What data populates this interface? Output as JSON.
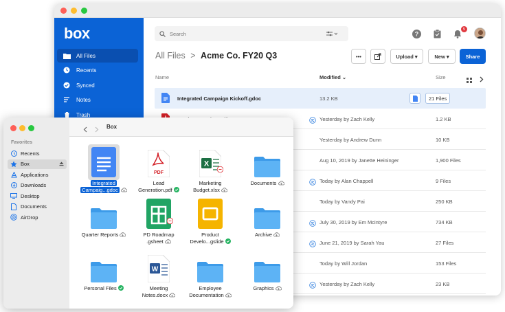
{
  "web": {
    "logo": "box",
    "nav": [
      {
        "label": "All Files",
        "icon": "folder-icon"
      },
      {
        "label": "Recents",
        "icon": "clock-icon"
      },
      {
        "label": "Synced",
        "icon": "check-circle-icon"
      },
      {
        "label": "Notes",
        "icon": "notes-icon"
      },
      {
        "label": "Trash",
        "icon": "trash-icon"
      }
    ],
    "search_placeholder": "Search",
    "notification_count": "5",
    "breadcrumb_parent": "All Files",
    "breadcrumb_sep": ">",
    "breadcrumb_current": "Acme Co. FY20 Q3",
    "more_label": "•••",
    "upload_label": "Upload ▾",
    "new_label": "New ▾",
    "share_label": "Share",
    "columns": {
      "name": "Name",
      "modified": "Modified ⌄",
      "size": "Size"
    },
    "files_count_label": "21 Files",
    "rows": [
      {
        "name": "Integrated Campaign Kickoff.gdoc",
        "modified": "13.2 KB",
        "size": "",
        "type": "gdoc",
        "synced": false,
        "selected": true
      },
      {
        "name": "Lead Generation.pdf",
        "modified": "Yesterday by Zach Kelly",
        "size": "1.2 KB",
        "type": "pdf",
        "synced": true
      },
      {
        "name": "",
        "modified": "Yesterday by Andrew Dunn",
        "size": "10 KB",
        "type": "none",
        "synced": false
      },
      {
        "name": "",
        "modified": "Aug 10, 2019 by Janette Heininger",
        "size": "1,900 Files",
        "type": "none",
        "synced": false
      },
      {
        "name": "",
        "modified": "Today by Alan Chappell",
        "size": "9 Files",
        "type": "none",
        "synced": true
      },
      {
        "name": "",
        "modified": "Today by Vandy Pai",
        "size": "250 KB",
        "type": "none",
        "synced": false
      },
      {
        "name": "",
        "modified": "July 30, 2019 by Em Mcintyre",
        "size": "734 KB",
        "type": "none",
        "synced": true
      },
      {
        "name": "",
        "modified": "June 21, 2019 by Sarah Yau",
        "size": "27 Files",
        "type": "none",
        "synced": true
      },
      {
        "name": "",
        "modified": "Today by Will Jordan",
        "size": "153 Files",
        "type": "none",
        "synced": false
      },
      {
        "name": "",
        "modified": "Yesterday by Zach Kelly",
        "size": "23 KB",
        "type": "none",
        "synced": true
      }
    ]
  },
  "finder": {
    "title": "Box",
    "favorites_header": "Favorites",
    "sidebar": [
      "Recents",
      "Box",
      "Applications",
      "Downloads",
      "Desktop",
      "Documents",
      "AirDrop"
    ],
    "items": [
      {
        "line1": "Integrated",
        "line2": "Campaig...gdoc",
        "kind": "gdoc",
        "status": "cloud"
      },
      {
        "line1": "Lead",
        "line2": "Generation.pdf",
        "kind": "pdf",
        "status": "check"
      },
      {
        "line1": "Marketing",
        "line2": "Budget.xlsx",
        "kind": "xlsx",
        "status": "cloud"
      },
      {
        "line1": "",
        "line2": "Documents",
        "kind": "folder",
        "status": "cloud"
      },
      {
        "line1": "",
        "line2": "Quarter Reports",
        "kind": "folder",
        "status": "cloud"
      },
      {
        "line1": "PD Roadmap",
        "line2": ".gsheet",
        "kind": "gsheet",
        "status": "cloud"
      },
      {
        "line1": "Product",
        "line2": "Develo...gslide",
        "kind": "gslide",
        "status": "check"
      },
      {
        "line1": "",
        "line2": "Archive",
        "kind": "folder",
        "status": "cloud"
      },
      {
        "line1": "",
        "line2": "Personal Files",
        "kind": "folder",
        "status": "check"
      },
      {
        "line1": "Meeting",
        "line2": "Notes.docx",
        "kind": "docx",
        "status": "cloud"
      },
      {
        "line1": "Employee",
        "line2": "Documentation",
        "kind": "folder",
        "status": "cloud"
      },
      {
        "line1": "",
        "line2": "Graphics",
        "kind": "folder",
        "status": "cloud"
      }
    ]
  },
  "colors": {
    "brand_blue": "#0b63d6",
    "folder_blue": "#4aa8ee",
    "check_green": "#28b463"
  }
}
